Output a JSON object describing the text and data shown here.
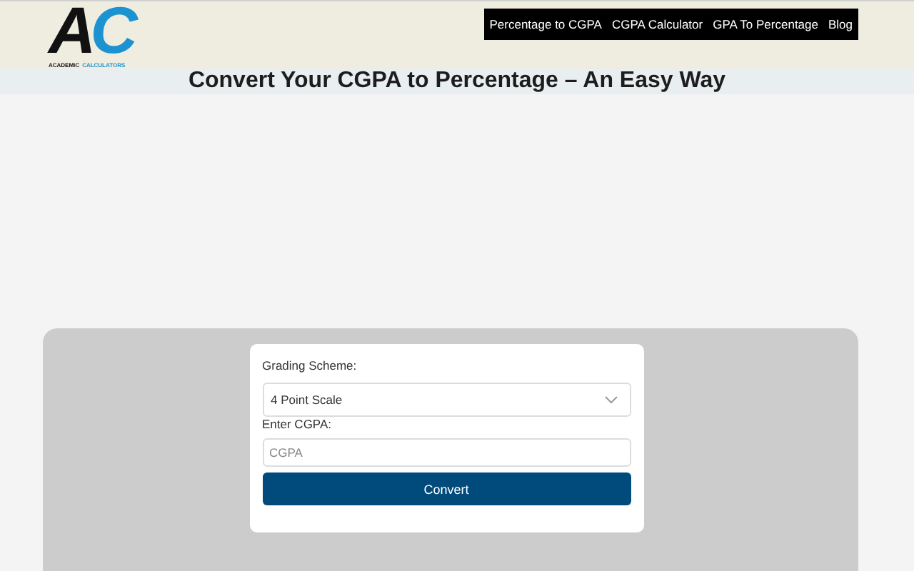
{
  "logo": {
    "letters": [
      "A",
      "C"
    ],
    "caption": [
      "ACADEMIC",
      "CALCULATORS"
    ]
  },
  "nav": [
    "Percentage to CGPA",
    "CGPA Calculator",
    "GPA To Percentage",
    "Blog"
  ],
  "title": "Convert Your CGPA to Percentage – An Easy Way",
  "form": {
    "scheme_label": "Grading Scheme:",
    "scheme_value": "4 Point Scale",
    "cgpa_label": "Enter CGPA:",
    "cgpa_placeholder": "CGPA",
    "button": "Convert"
  }
}
